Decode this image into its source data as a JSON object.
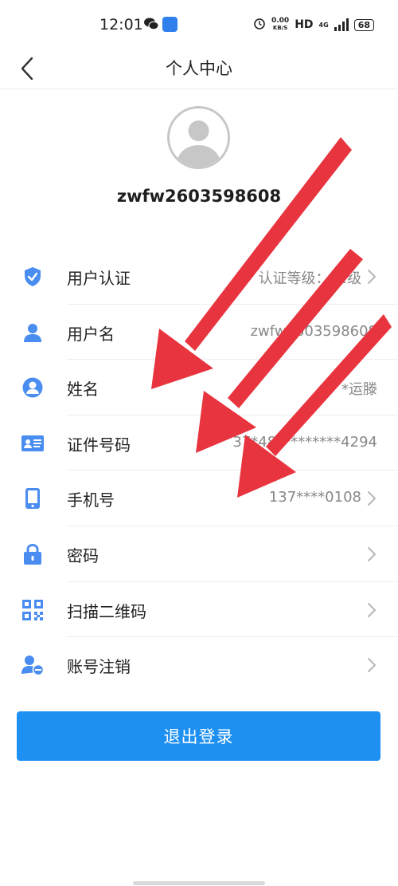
{
  "status_bar": {
    "time": "12:01",
    "speed_value": "0.00",
    "speed_unit": "KB/S",
    "hd": "HD",
    "network": "4G",
    "battery": "68"
  },
  "nav": {
    "title": "个人中心"
  },
  "profile": {
    "username": "zwfw2603598608"
  },
  "menu": [
    {
      "label": "用户认证",
      "value": "认证等级：L1级",
      "chevron": true,
      "icon": "shield-check-icon"
    },
    {
      "label": "用户名",
      "value": "zwfw2603598608",
      "chevron": false,
      "icon": "user-icon"
    },
    {
      "label": "姓名",
      "value": "*运滕",
      "chevron": false,
      "icon": "user-circle-icon"
    },
    {
      "label": "证件号码",
      "value": "37*48*********4294",
      "chevron": false,
      "icon": "id-card-icon"
    },
    {
      "label": "手机号",
      "value": "137****0108",
      "chevron": true,
      "icon": "phone-icon"
    },
    {
      "label": "密码",
      "value": "",
      "chevron": true,
      "icon": "lock-icon"
    },
    {
      "label": "扫描二维码",
      "value": "",
      "chevron": true,
      "icon": "qr-code-icon"
    },
    {
      "label": "账号注销",
      "value": "",
      "chevron": true,
      "icon": "user-remove-icon"
    }
  ],
  "logout": {
    "label": "退出登录"
  },
  "colors": {
    "accent": "#1e90f2",
    "icon_blue": "#4a8df0",
    "annotation_red": "#e8343f"
  }
}
